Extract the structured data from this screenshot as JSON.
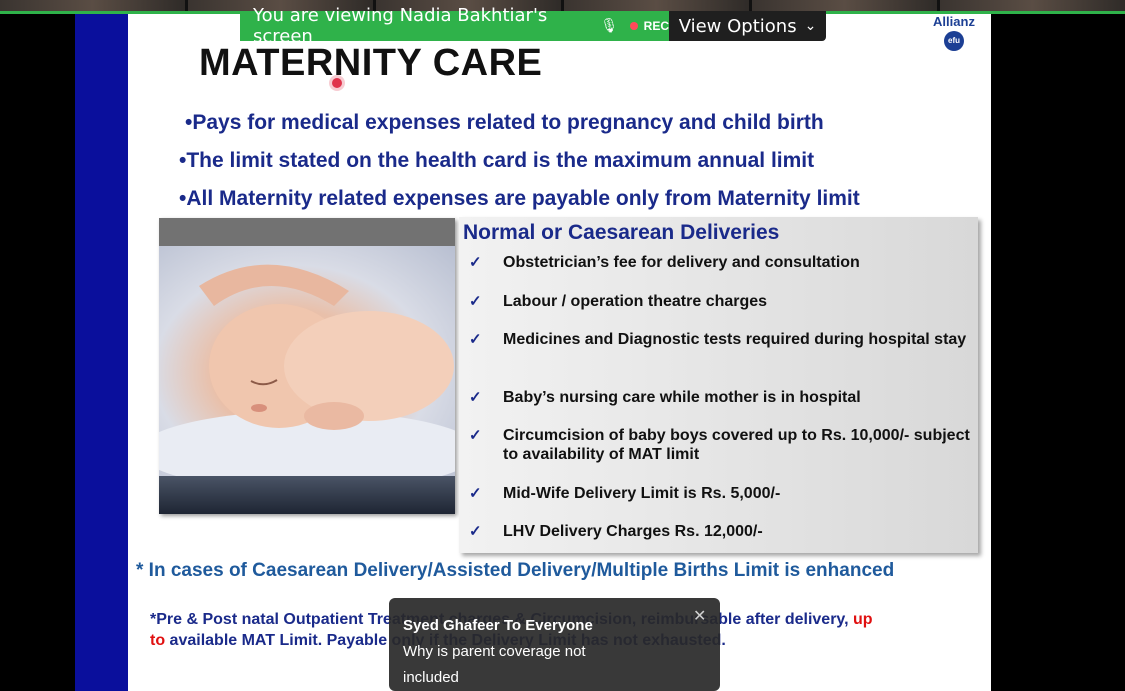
{
  "share_banner": {
    "viewing_text": "You are viewing Nadia Bakhtiar's screen",
    "rec_label": "REC",
    "view_options_label": "View Options"
  },
  "slide": {
    "title": "MATERNITY CARE",
    "logo": {
      "brand": "Allianz",
      "sub": "efu"
    },
    "bullets": [
      "•Pays for medical expenses related to pregnancy and child birth",
      "•The limit stated on the health card is the maximum annual limit",
      "•All Maternity related expenses are payable only from Maternity limit"
    ],
    "box": {
      "title": "Normal or Caesarean Deliveries",
      "items": [
        "Obstetrician’s fee for delivery and consultation",
        " Labour / operation theatre charges",
        " Medicines and Diagnostic tests required during hospital stay",
        " Baby’s nursing care while mother is in hospital",
        " Circumcision of baby boys covered up to Rs. 10,000/- subject to availability of MAT limit",
        " Mid-Wife Delivery Limit is Rs. 5,000/-",
        " LHV Delivery Charges Rs. 12,000/-"
      ]
    },
    "note1": "* In cases of Caesarean Delivery/Assisted Delivery/Multiple Births Limit is enhanced",
    "note2_main": "*Pre & Post natal Outpatient Treatment charges & Circumcision, reimbursable after delivery, ",
    "note2_red1": "up",
    "note2_red2": "to",
    "note2_end": " available  MAT Limit. Payable only if the Delivery Limit has not exhausted."
  },
  "chat_toast": {
    "sender": "Syed Ghafeer To Everyone",
    "message": "Why is parent coverage not included"
  },
  "colors": {
    "share_green": "#2fb24a",
    "slide_blue_bar": "#0a0f9c",
    "text_navy": "#1a2a8a",
    "accent_red": "#e01010"
  }
}
